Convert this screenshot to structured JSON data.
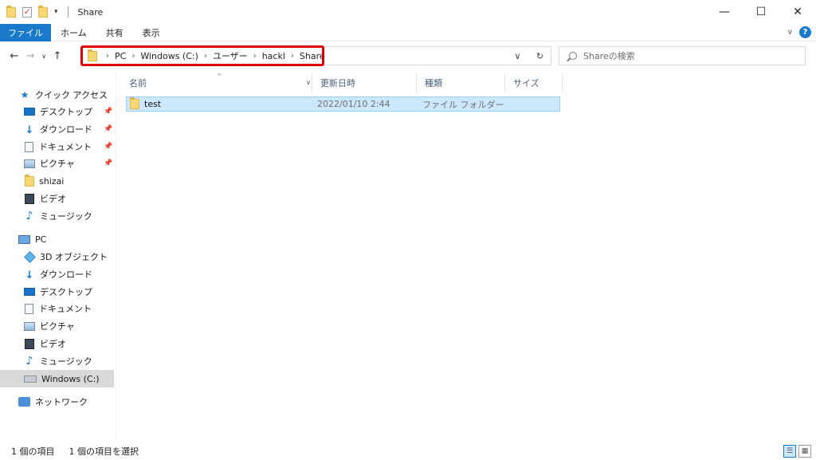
{
  "window": {
    "title": "Share",
    "minimize": "—",
    "maximize": "☐",
    "close": "✕"
  },
  "ribbon": {
    "tabs": [
      "ファイル",
      "ホーム",
      "共有",
      "表示"
    ]
  },
  "nav": {
    "back": "←",
    "forward": "→",
    "recent": "∨",
    "up": "↑",
    "breadcrumb": [
      "PC",
      "Windows (C:)",
      "ユーザー",
      "hackl",
      "Share"
    ],
    "address_dropdown": "∨",
    "refresh": "↻",
    "search_placeholder": "Shareの検索"
  },
  "sidebar": {
    "quick_access": {
      "label": "クイック アクセス",
      "items": [
        {
          "label": "デスクトップ",
          "icon": "desktop-icon",
          "pinned": true
        },
        {
          "label": "ダウンロード",
          "icon": "download-icon",
          "pinned": true
        },
        {
          "label": "ドキュメント",
          "icon": "document-icon",
          "pinned": true
        },
        {
          "label": "ピクチャ",
          "icon": "picture-icon",
          "pinned": true
        },
        {
          "label": "shizai",
          "icon": "folder-icon",
          "pinned": false
        },
        {
          "label": "ビデオ",
          "icon": "video-icon",
          "pinned": false
        },
        {
          "label": "ミュージック",
          "icon": "music-icon",
          "pinned": false
        }
      ]
    },
    "pc": {
      "label": "PC",
      "items": [
        {
          "label": "3D オブジェクト",
          "icon": "3d-objects-icon"
        },
        {
          "label": "ダウンロード",
          "icon": "download-icon"
        },
        {
          "label": "デスクトップ",
          "icon": "desktop-icon"
        },
        {
          "label": "ドキュメント",
          "icon": "document-icon"
        },
        {
          "label": "ピクチャ",
          "icon": "picture-icon"
        },
        {
          "label": "ビデオ",
          "icon": "video-icon"
        },
        {
          "label": "ミュージック",
          "icon": "music-icon"
        },
        {
          "label": "Windows (C:)",
          "icon": "drive-icon",
          "selected": true
        }
      ]
    },
    "network": {
      "label": "ネットワーク"
    }
  },
  "list": {
    "columns": [
      "名前",
      "更新日時",
      "種類",
      "サイズ"
    ],
    "rows": [
      {
        "name": "test",
        "modified": "2022/01/10 2:44",
        "type": "ファイル フォルダー",
        "size": ""
      }
    ]
  },
  "status": {
    "item_count": "1 個の項目",
    "selected_count": "1 個の項目を選択"
  },
  "colors": {
    "accent": "#1979ca",
    "highlight_box": "#e00000",
    "selection": "#cce8ff"
  }
}
